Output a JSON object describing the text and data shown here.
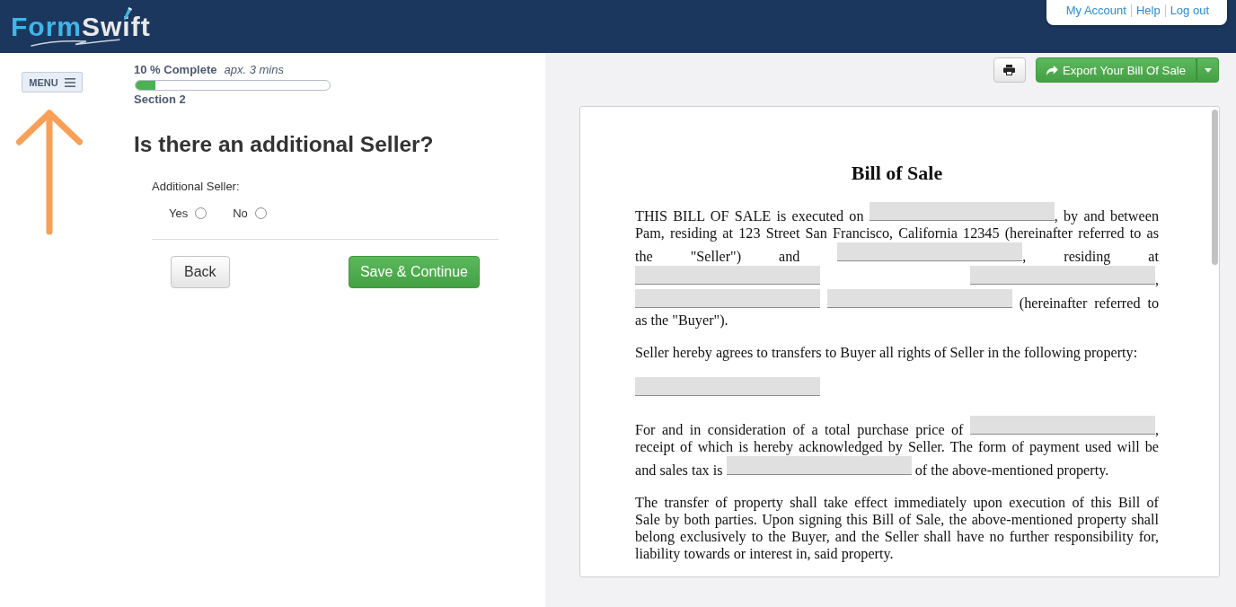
{
  "header": {
    "logo": [
      "Form",
      "Swift"
    ],
    "account_links": [
      "My Account",
      "Help",
      "Log out"
    ]
  },
  "menu_button": {
    "label": "MENU"
  },
  "progress": {
    "label": "10 % Complete",
    "estimate": "apx. 3 mins",
    "level": 0.1,
    "section": "Section 2"
  },
  "question": {
    "title": "Is there an additional Seller?",
    "field_label": "Additional Seller:",
    "options": [
      {
        "label": "Yes",
        "selected": false
      },
      {
        "label": "No",
        "selected": false
      }
    ]
  },
  "buttons": [
    {
      "label": "Back",
      "kind": "secondary"
    },
    {
      "label": "Save & Continue",
      "kind": "primary"
    }
  ],
  "toolbar": {
    "export_button": {
      "label": "Export Your Bill Of Sale"
    }
  },
  "document": {
    "title": "Bill of Sale",
    "paragraphs": [
      {
        "lines": [
          [
            {
              "kind": "text",
              "text": "THIS BILL OF SALE is executed on "
            },
            {
              "kind": "blank"
            },
            {
              "kind": "text",
              "text": ", by and between"
            }
          ],
          [
            {
              "kind": "text",
              "text": "Pam, residing at 123 Street San Francisco, California 12345 (hereinafter referred to as"
            }
          ],
          [
            {
              "kind": "text",
              "text": "the \"Seller\") and "
            },
            {
              "kind": "blank"
            },
            {
              "kind": "text",
              "text": ", residing at"
            }
          ],
          [
            {
              "kind": "blank"
            },
            {
              "kind": "blank"
            },
            {
              "kind": "text",
              "text": ","
            }
          ],
          [
            {
              "kind": "blank"
            },
            {
              "kind": "blank"
            },
            {
              "kind": "text",
              "text": " (hereinafter referred to"
            }
          ],
          [
            {
              "kind": "text",
              "text": "as the \"Buyer\")."
            }
          ]
        ]
      },
      {
        "lines": [
          [
            {
              "kind": "text",
              "text": "Seller hereby agrees to transfers to Buyer all rights of Seller in the following property:"
            }
          ]
        ]
      },
      {
        "lines": [
          [
            {
              "kind": "blank"
            }
          ]
        ]
      },
      {
        "lines": [
          [
            {
              "kind": "text",
              "text": "For and in consideration of a total purchase price of "
            },
            {
              "kind": "blank"
            },
            {
              "kind": "text",
              "text": ","
            }
          ],
          [
            {
              "kind": "text",
              "text": "receipt of which is hereby acknowledged by Seller. The form of payment used will be"
            }
          ],
          [
            {
              "kind": "text",
              "text": "and sales tax is "
            },
            {
              "kind": "blank"
            },
            {
              "kind": "text",
              "text": " of the above-mentioned property."
            }
          ]
        ]
      },
      {
        "lines": [
          [
            {
              "kind": "text",
              "text": "The transfer of property shall take effect immediately upon execution of this Bill of"
            }
          ],
          [
            {
              "kind": "text",
              "text": "Sale by both parties. Upon signing this Bill of Sale, the above-mentioned property shall"
            }
          ],
          [
            {
              "kind": "text",
              "text": "belong exclusively to the Buyer, and the Seller shall have no further responsibility for,"
            }
          ],
          [
            {
              "kind": "text",
              "text": "liability towards or interest in, said property."
            }
          ]
        ]
      }
    ]
  }
}
